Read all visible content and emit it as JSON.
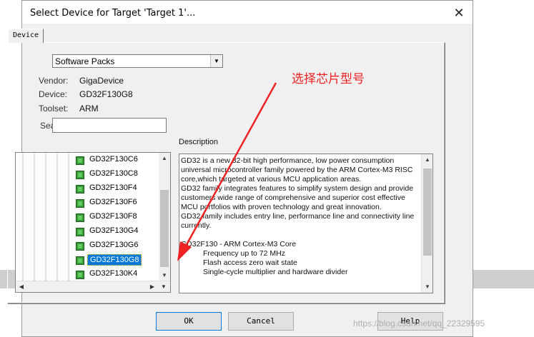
{
  "window": {
    "title": "Select Device for Target 'Target 1'...",
    "close_glyph": "✕"
  },
  "tabs": [
    {
      "label": "Device"
    }
  ],
  "device_db_select": {
    "value": "Software Packs"
  },
  "info": {
    "vendor_label": "Vendor:",
    "vendor_value": "GigaDevice",
    "device_label": "Device:",
    "device_value": "GD32F130G8",
    "toolset_label": "Toolset:",
    "toolset_value": "ARM",
    "search_label": "Search:",
    "search_value": ""
  },
  "device_list": [
    {
      "name": "GD32F130C6",
      "selected": false
    },
    {
      "name": "GD32F130C8",
      "selected": false
    },
    {
      "name": "GD32F130F4",
      "selected": false
    },
    {
      "name": "GD32F130F6",
      "selected": false
    },
    {
      "name": "GD32F130F8",
      "selected": false
    },
    {
      "name": "GD32F130G4",
      "selected": false
    },
    {
      "name": "GD32F130G6",
      "selected": false
    },
    {
      "name": "GD32F130G8",
      "selected": true
    },
    {
      "name": "GD32F130K4",
      "selected": false
    }
  ],
  "description": {
    "label": "Description",
    "lines": [
      {
        "text": "GD32 is a new 32-bit high performance, low power consumption",
        "indent": false
      },
      {
        "text": "universal microcontroller family powered by the ARM Cortex-M3 RISC",
        "indent": false
      },
      {
        "text": "core,which targeted at various MCU application areas.",
        "indent": false
      },
      {
        "text": "GD32 family integrates features to simplify system design and provide",
        "indent": false
      },
      {
        "text": "customers wide range of comprehensive and superior cost effective",
        "indent": false
      },
      {
        "text": "MCU portfolios with proven technology and great innovation.",
        "indent": false
      },
      {
        "text": "GD32 family includes entry line, performance line and connectivity line",
        "indent": false
      },
      {
        "text": "currently.",
        "indent": false
      },
      {
        "text": "",
        "indent": false
      },
      {
        "text": "GD32F130 - ARM Cortex-M3 Core",
        "indent": false
      },
      {
        "text": "Frequency up to 72 MHz",
        "indent": true
      },
      {
        "text": "Flash access zero wait state",
        "indent": true
      },
      {
        "text": "Single-cycle multiplier and hardware divider",
        "indent": true
      }
    ]
  },
  "buttons": {
    "ok": "OK",
    "cancel": "Cancel",
    "help": "Help"
  },
  "annotation": {
    "text": "选择芯片型号",
    "color": "#ee2222"
  },
  "watermark": "https://blog.csdn.net/qq_22329595",
  "colors": {
    "selection": "#0078d7",
    "chip": "#3a9a3a",
    "arrow": "#ee2222"
  }
}
